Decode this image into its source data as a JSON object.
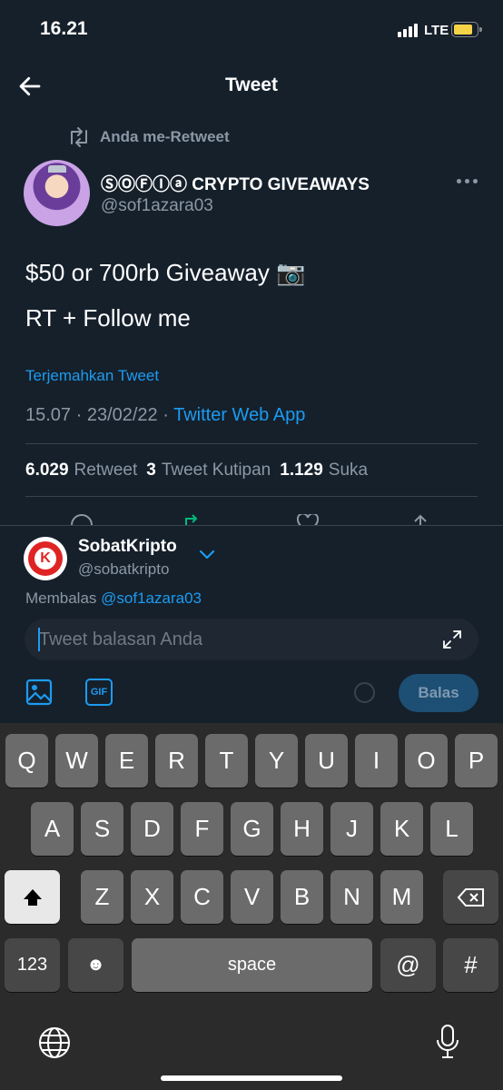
{
  "status_bar": {
    "time": "16.21",
    "network": "LTE",
    "battery_level": 0.85
  },
  "header": {
    "title": "Tweet"
  },
  "retweet_context": {
    "label": "Anda me-Retweet"
  },
  "tweet": {
    "author_name": "ⓈⓄⒻⒾⓐ CRYPTO GIVEAWAYS",
    "author_handle": "@sof1azara03",
    "text_line1": "$50 or 700rb Giveaway 📷",
    "text_line2": "RT + Follow me",
    "translate_label": "Terjemahkan Tweet",
    "timestamp": "15.07 · 23/02/22 ·",
    "source_app": "Twitter Web App",
    "stats": [
      {
        "count": "6.029",
        "label": "Retweet"
      },
      {
        "count": "3",
        "label": "Tweet Kutipan"
      },
      {
        "count": "1.129",
        "label": "Suka"
      }
    ]
  },
  "reply": {
    "account_name": "SobatKripto",
    "account_handle": "@sobatkripto",
    "avatar_letter": "K",
    "replying_prefix": "Membalas",
    "replying_handle": "@sof1azara03",
    "placeholder": "Tweet balasan Anda",
    "gif_label": "GIF",
    "reply_button": "Balas"
  },
  "keyboard": {
    "row1": [
      "Q",
      "W",
      "E",
      "R",
      "T",
      "Y",
      "U",
      "I",
      "O",
      "P"
    ],
    "row2": [
      "A",
      "S",
      "D",
      "F",
      "G",
      "H",
      "J",
      "K",
      "L"
    ],
    "row3": [
      "Z",
      "X",
      "C",
      "V",
      "B",
      "N",
      "M"
    ],
    "numbers_key": "123",
    "space_key": "space",
    "at_key": "@",
    "hash_key": "#",
    "emoji_key": "☻"
  },
  "colors": {
    "background": "#15202b",
    "accent": "#1d9bf0",
    "muted": "#8b98a5",
    "retweet_green": "#00ba7c"
  }
}
